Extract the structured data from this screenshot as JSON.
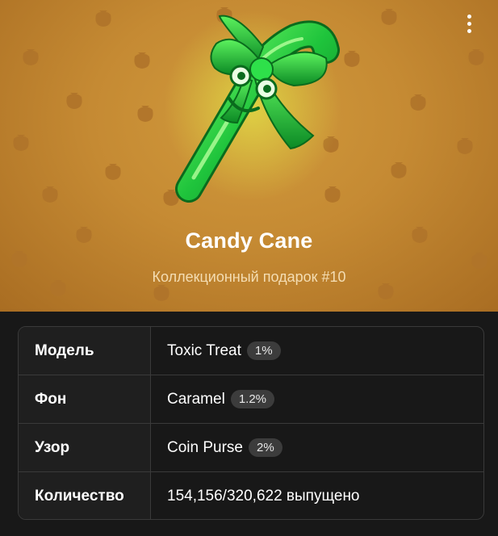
{
  "header": {
    "menu_icon": "more-vertical-icon",
    "background_color": "#c58a33",
    "pattern_icon": "coin-purse-icon"
  },
  "gift": {
    "title": "Candy Cane",
    "subtitle": "Коллекционный подарок #10",
    "art_icon": "green-candy-cane-with-bow",
    "accent_color": "#1fc43c"
  },
  "properties": [
    {
      "label": "Модель",
      "value": "Toxic Treat",
      "badge": "1%"
    },
    {
      "label": "Фон",
      "value": "Caramel",
      "badge": "1.2%"
    },
    {
      "label": "Узор",
      "value": "Coin Purse",
      "badge": "2%"
    },
    {
      "label": "Количество",
      "value": "154,156/320,622 выпущено"
    }
  ]
}
